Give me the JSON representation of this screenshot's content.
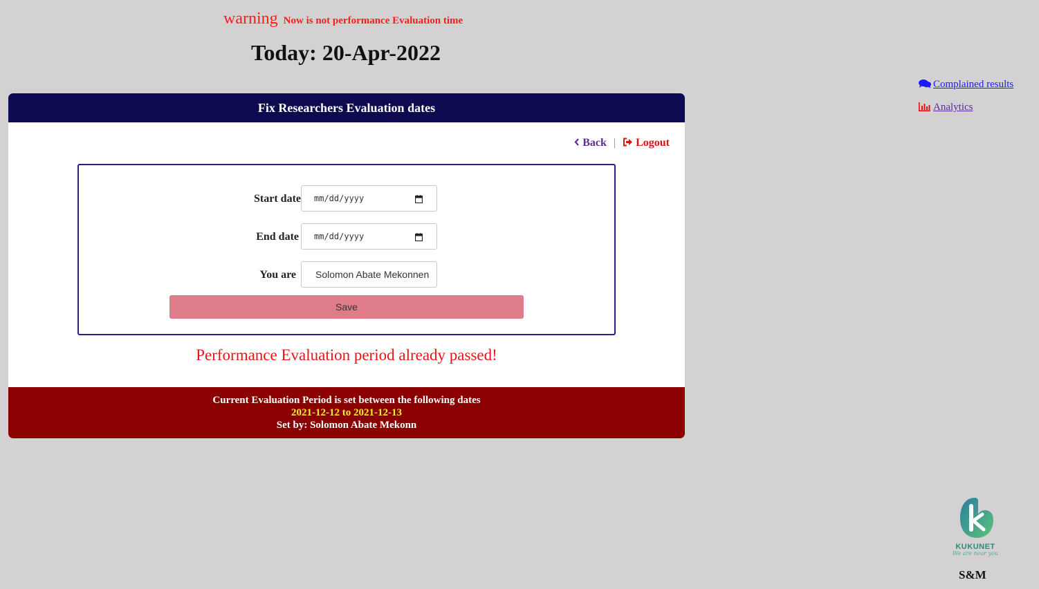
{
  "warning": {
    "label": "warning",
    "message": "Now is not performance Evaluation time"
  },
  "today": "Today: 20-Apr-2022",
  "side_links": {
    "complained": "Complained results",
    "analytics": "Analytics"
  },
  "card": {
    "title": "Fix Researchers Evaluation dates",
    "nav": {
      "back": "Back",
      "logout": "Logout"
    },
    "form": {
      "start_label": "Start date",
      "start_value": "mm/dd/yyyy",
      "end_label": "End date",
      "end_value": "mm/dd/yyyy",
      "you_are_label": "You are",
      "you_are_value": "Solomon Abate Mekonnen",
      "save_label": "Save"
    },
    "status_message": "Performance Evaluation period already passed!",
    "footer": {
      "line1": "Current Evaluation Period is set between the following dates",
      "dates": "2021-12-12 to 2021-12-13",
      "set_by": "Set by: Solomon Abate Mekonn"
    }
  },
  "logo": {
    "name": "KUKUNET",
    "tagline": "We are near you"
  },
  "brand": "S&M",
  "colors": {
    "background": "#d3d1d2",
    "header": "#0d0a4f",
    "footer": "#8b0000",
    "warning": "#ff1a1a",
    "save_button": "#df7c89",
    "footer_dates": "#ffee33"
  }
}
